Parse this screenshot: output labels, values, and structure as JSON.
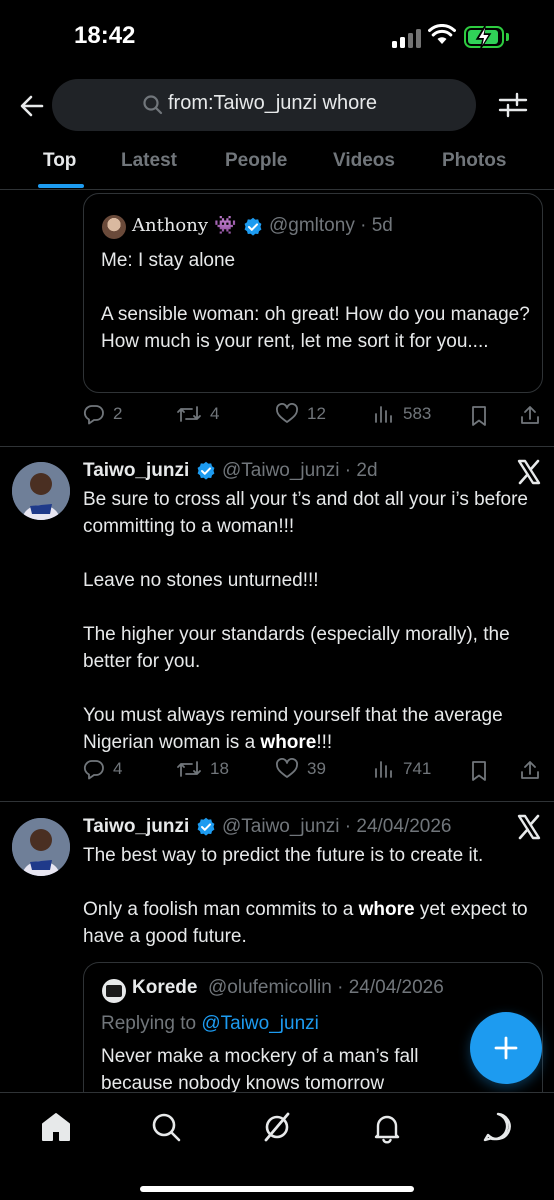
{
  "status_bar": {
    "time": "18:42"
  },
  "search": {
    "query": "from:Taiwo_junzi whore"
  },
  "tabs": [
    {
      "label": "Top",
      "active": true
    },
    {
      "label": "Latest",
      "active": false
    },
    {
      "label": "People",
      "active": false
    },
    {
      "label": "Videos",
      "active": false
    },
    {
      "label": "Photos",
      "active": false
    }
  ],
  "quoted_tweet_1": {
    "name": "Anthony",
    "name_emoji": "👾",
    "handle_time": "@gmltony · 5d",
    "text": "Me: I stay alone\n\nA sensible woman: oh great! How do you manage? How much is your rent, let me sort it for you...."
  },
  "tweet_0_actions": {
    "replies": "2",
    "reposts": "4",
    "likes": "12",
    "views": "583"
  },
  "tweet_1": {
    "name": "Taiwo_junzi",
    "handle_time": "@Taiwo_junzi · 2d",
    "text_a": "Be sure to cross all your t’s and dot all your i’s before committing to a woman!!!\n\nLeave no stones unturned!!!\n\nThe higher your standards (especially morally), the better for you.\n\nYou must always remind yourself that the average Nigerian woman is a ",
    "text_bold": "whore",
    "text_b": "!!!",
    "replies": "4",
    "reposts": "18",
    "likes": "39",
    "views": "741"
  },
  "tweet_2": {
    "name": "Taiwo_junzi",
    "handle_time": "@Taiwo_junzi · 24/04/2026",
    "text_a": "The best way to predict the future is to create it.\n\nOnly a foolish man commits to a ",
    "text_bold": "whore",
    "text_b": " yet expect to have a good future."
  },
  "quoted_tweet_2": {
    "name": "Korede",
    "handle_time": "@olufemicollin · 24/04/2026",
    "replying_prefix": "Replying to ",
    "replying_handle": "@Taiwo_junzi",
    "text": "Never make a mockery of a man’s fall because nobody knows tomorrow"
  },
  "colors": {
    "accent": "#1d9bf0",
    "muted": "#71767b",
    "background": "#000000",
    "border": "#2f3336"
  },
  "icons": [
    "back-arrow-icon",
    "search-icon",
    "filter-icon",
    "reply-icon",
    "repost-icon",
    "like-icon",
    "views-icon",
    "bookmark-icon",
    "share-icon",
    "x-logo-icon",
    "verified-icon",
    "compose-icon",
    "home-icon",
    "explore-icon",
    "grok-icon",
    "notifications-icon",
    "messages-icon"
  ]
}
